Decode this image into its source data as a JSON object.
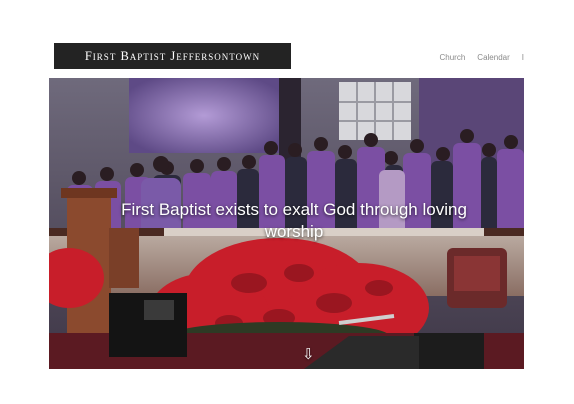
{
  "header": {
    "logo_text": "First Baptist Jeffersontown",
    "nav": {
      "items": [
        {
          "label": "Church"
        },
        {
          "label": "Calendar"
        }
      ],
      "more_label": "I"
    }
  },
  "hero": {
    "tagline": "First Baptist exists to exalt God through loving worship",
    "scroll_icon": "down-arrow-icon",
    "scroll_glyph": "⇩"
  },
  "colors": {
    "logo_bg": "#232323",
    "robes": "#7b4fa3",
    "poinsettia": "#c81e2a",
    "nav_text": "#8a8a8a"
  }
}
